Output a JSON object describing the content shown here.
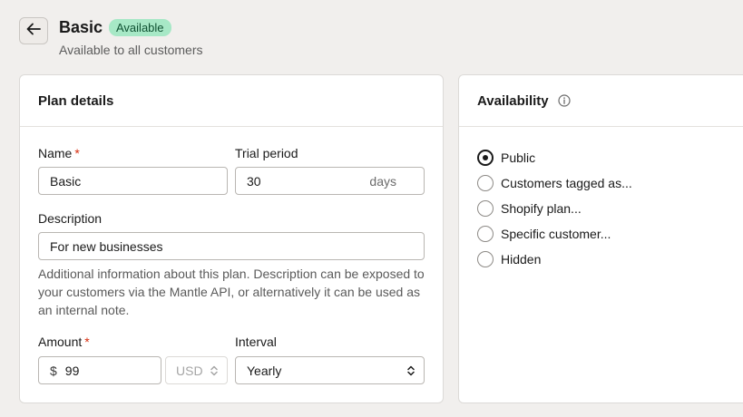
{
  "header": {
    "back_icon": "arrow-left-icon",
    "title": "Basic",
    "status": "Available",
    "subtitle": "Available to all customers",
    "status_color": "#a7e8c6"
  },
  "plan_details": {
    "title": "Plan details",
    "name": {
      "label": "Name",
      "required": "*",
      "value": "Basic"
    },
    "trial": {
      "label": "Trial period",
      "value": "30",
      "suffix": "days"
    },
    "description": {
      "label": "Description",
      "value": "For new businesses",
      "help": "Additional information about this plan. Description can be exposed to your customers via the Mantle API, or alternatively it can be used as an internal note."
    },
    "amount": {
      "label": "Amount",
      "required": "*",
      "prefix": "$",
      "value": "99",
      "currency": "USD"
    },
    "interval": {
      "label": "Interval",
      "value": "Yearly"
    }
  },
  "availability": {
    "title": "Availability",
    "info_icon": "info-icon",
    "options": [
      {
        "label": "Public",
        "checked": true
      },
      {
        "label": "Customers tagged as...",
        "checked": false
      },
      {
        "label": "Shopify plan...",
        "checked": false
      },
      {
        "label": "Specific customer...",
        "checked": false
      },
      {
        "label": "Hidden",
        "checked": false
      }
    ]
  }
}
